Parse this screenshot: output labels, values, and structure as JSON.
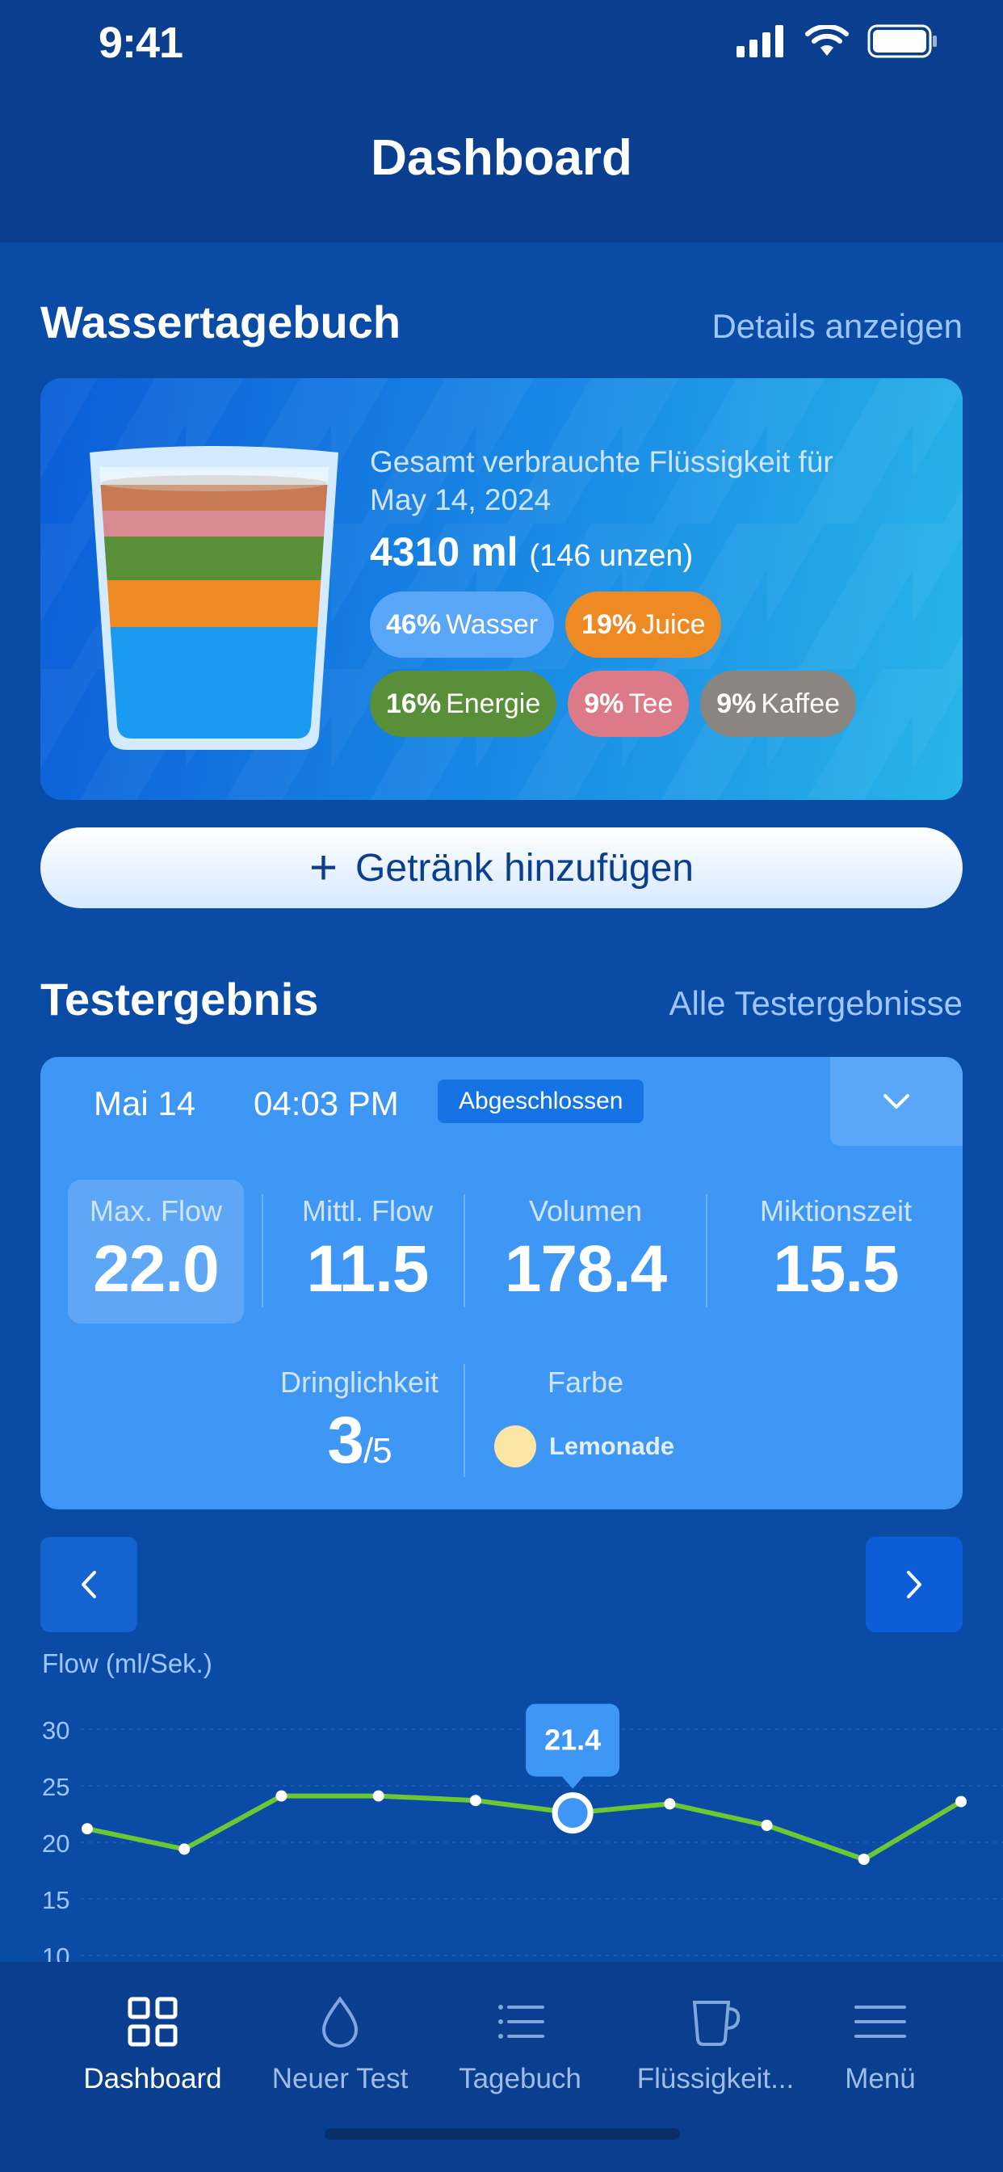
{
  "status_bar": {
    "time": "9:41"
  },
  "header": {
    "title": "Dashboard"
  },
  "water_diary": {
    "title": "Wassertagebuch",
    "details_link": "Details anzeigen",
    "total_label": "Gesamt verbrauchte Flüssigkeit für",
    "date": "May 14, 2024",
    "total_amount": "4310 ml",
    "total_ounces": "(146 unzen)",
    "breakdown": [
      {
        "percent": "46%",
        "label": "Wasser",
        "color": "#5aa6f8"
      },
      {
        "percent": "19%",
        "label": "Juice",
        "color": "#ee8a24"
      },
      {
        "percent": "16%",
        "label": "Energie",
        "color": "#5a8f3a"
      },
      {
        "percent": "9%",
        "label": "Tee",
        "color": "#dc7a8a"
      },
      {
        "percent": "9%",
        "label": "Kaffee",
        "color": "#8a8580"
      }
    ],
    "add_button": "Getränk hinzufügen"
  },
  "test_result": {
    "title": "Testergebnis",
    "all_link": "Alle Testergebnisse",
    "date": "Mai 14",
    "time": "04:03 PM",
    "status": "Abgeschlossen",
    "stats": [
      {
        "label": "Max. Flow",
        "value": "22.0"
      },
      {
        "label": "Mittl. Flow",
        "value": "11.5"
      },
      {
        "label": "Volumen",
        "value": "178.4"
      },
      {
        "label": "Miktionszeit",
        "value": "15.5"
      }
    ],
    "urgency_label": "Dringlichkeit",
    "urgency_value": "3",
    "urgency_max": "/5",
    "color_label": "Farbe",
    "color_name": "Lemonade",
    "color_hex": "#fbe6a6"
  },
  "chart_data": {
    "type": "line",
    "ylabel": "Flow (ml/Sek.)",
    "y_ticks": [
      "30",
      "25",
      "20",
      "15",
      "10"
    ],
    "ylim": [
      10,
      30
    ],
    "series": [
      {
        "values": [
          21.2,
          19.4,
          24.1,
          24.1,
          23.7,
          22.6,
          23.4,
          21.5,
          18.5,
          23.6
        ]
      }
    ],
    "highlight": {
      "index": 5,
      "label": "21.4"
    },
    "line_color": "#6cc832"
  },
  "tabbar": {
    "items": [
      {
        "label": "Dashboard",
        "icon": "grid-icon",
        "active": true
      },
      {
        "label": "Neuer Test",
        "icon": "drop-icon",
        "active": false
      },
      {
        "label": "Tagebuch",
        "icon": "list-icon",
        "active": false
      },
      {
        "label": "Flüssigkeit...",
        "icon": "cup-icon",
        "active": false
      },
      {
        "label": "Menü",
        "icon": "menu-icon",
        "active": false
      }
    ]
  }
}
